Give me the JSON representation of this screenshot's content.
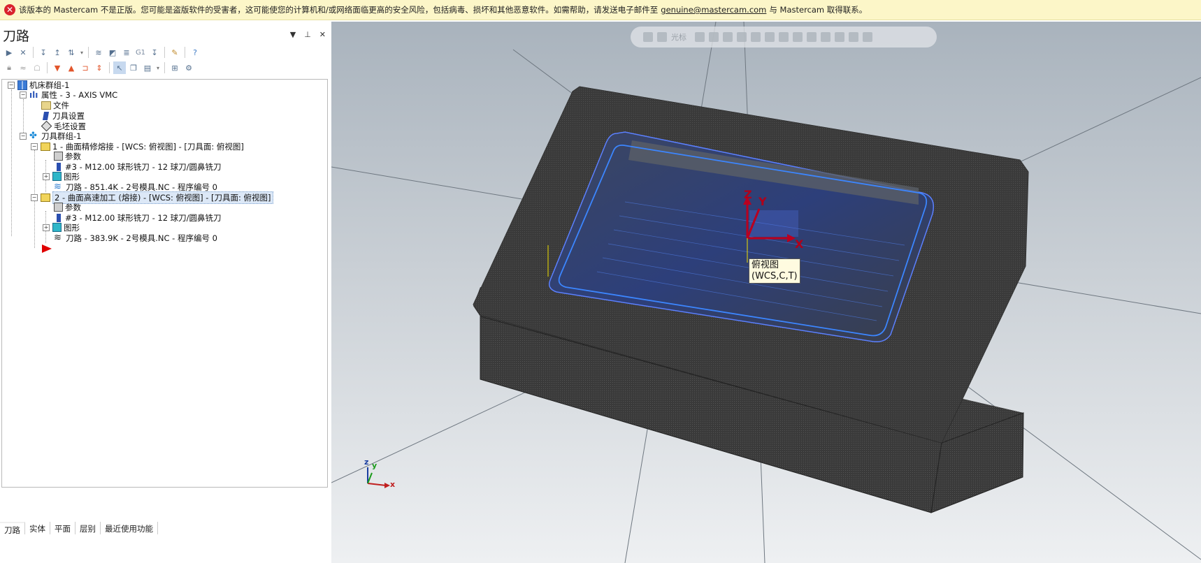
{
  "warning": {
    "message": "该版本的 Mastercam 不是正版。您可能是盗版软件的受害者，这可能使您的计算机和/或网络面临更高的安全风险，包括病毒、损坏和其他恶意软件。如需帮助，请发送电子邮件至",
    "email": "genuine@mastercam.com",
    "suffix": "与 Mastercam 取得联系。"
  },
  "panel": {
    "title": "刀路",
    "controls": [
      "▼",
      "⊥",
      "✕"
    ]
  },
  "tree": {
    "machine_group": "机床群组-1",
    "properties": "属性 - 3 - AXIS VMC",
    "files": "文件",
    "tool_settings": "刀具设置",
    "stock_settings": "毛坯设置",
    "toolpath_group": "刀具群组-1",
    "op1": {
      "label": "1 - 曲面精修熔接 - [WCS: 俯视图] - [刀具面: 俯视图]",
      "params": "参数",
      "tool": "#3 - M12.00 球形铣刀 - 12 球刀/圆鼻铣刀",
      "geometry": "图形",
      "toolpath": "刀路 - 851.4K - 2号模具.NC - 程序编号 0"
    },
    "op2": {
      "label": "2 - 曲面高速加工 (熔接) - [WCS: 俯视图] - [刀具面: 俯视图]",
      "params": "参数",
      "tool": "#3 - M12.00 球形铣刀 - 12 球刀/圆鼻铣刀",
      "geometry": "图形",
      "toolpath": "刀路 - 383.9K - 2号模具.NC - 程序编号 0"
    }
  },
  "bottom_tabs": [
    "刀路",
    "实体",
    "平面",
    "层别",
    "最近使用功能"
  ],
  "viewport": {
    "toolbar_label": "光标",
    "tooltip_line1": "俯视图",
    "tooltip_line2": "(WCS,C,T)",
    "axis_x": "X",
    "axis_y": "Y",
    "axis_z": "Z",
    "triad_x": "x",
    "triad_y": "y",
    "triad_z": "z"
  },
  "colors": {
    "warning_bg": "#fcf6c8",
    "toolpath_blue": "#2f6fe0",
    "part_dark": "#3a3a3a"
  }
}
